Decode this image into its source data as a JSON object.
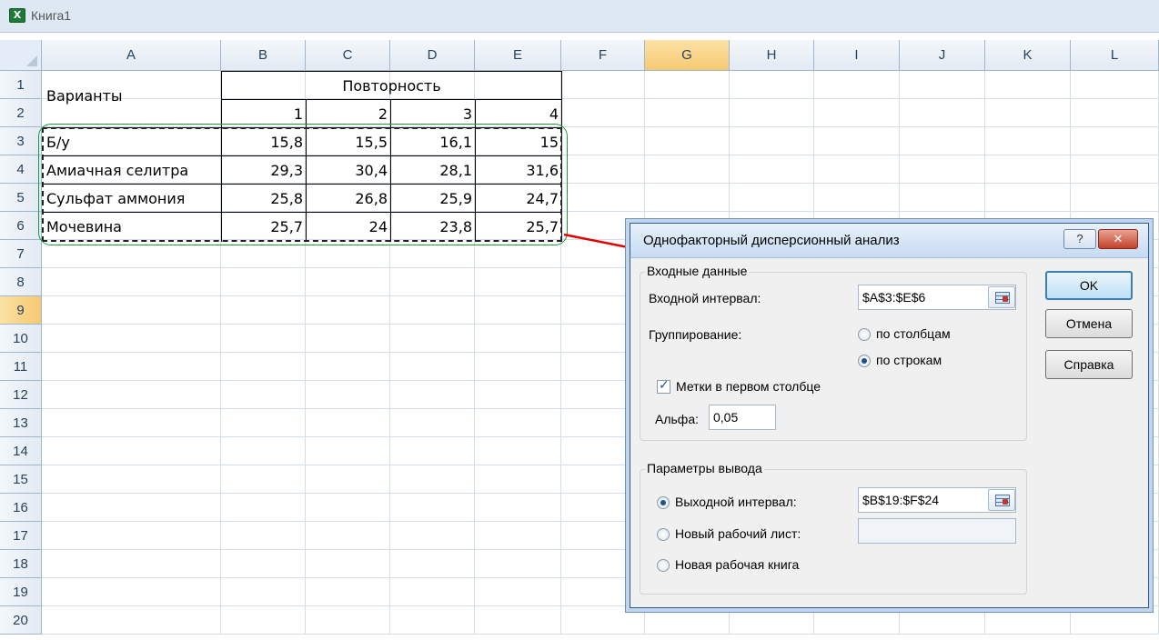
{
  "window": {
    "title": "Книга1",
    "app_icon": "excel-icon"
  },
  "columns": [
    "A",
    "B",
    "C",
    "D",
    "E",
    "F",
    "G",
    "H",
    "I",
    "J",
    "K",
    "L"
  ],
  "rows": [
    "1",
    "2",
    "3",
    "4",
    "5",
    "6",
    "7",
    "8",
    "9",
    "10",
    "11",
    "12",
    "13",
    "14",
    "15",
    "16",
    "17",
    "18",
    "19",
    "20"
  ],
  "active": {
    "column": "G",
    "row": "9"
  },
  "table": {
    "header_variants": "Варианты",
    "header_repeat": "Повторность",
    "repeat_numbers": [
      "1",
      "2",
      "3",
      "4"
    ],
    "data": [
      {
        "name": "Б/у",
        "values": [
          "15,8",
          "15,5",
          "16,1",
          "15"
        ]
      },
      {
        "name": "Амиачная селитра",
        "values": [
          "29,3",
          "30,4",
          "28,1",
          "31,6"
        ]
      },
      {
        "name": "Сульфат аммония",
        "values": [
          "25,8",
          "26,8",
          "25,9",
          "24,7"
        ]
      },
      {
        "name": "Мочевина",
        "values": [
          "25,7",
          "24",
          "23,8",
          "25,7"
        ]
      }
    ]
  },
  "dialog": {
    "title": "Однофакторный дисперсионный анализ",
    "help_glyph": "?",
    "close_glyph": "✕",
    "input_group": "Входные данные",
    "input_range_label": "Входной интервал:",
    "input_range_value": "$A$3:$E$6",
    "grouping_label": "Группирование:",
    "by_columns": "по столбцам",
    "by_rows": "по строкам",
    "labels_checkbox": "Метки в первом столбце",
    "alpha_label": "Альфа:",
    "alpha_value": "0,05",
    "output_group": "Параметры вывода",
    "output_range_label": "Выходной интервал:",
    "output_range_value": "$B$19:$F$24",
    "new_sheet": "Новый рабочий лист:",
    "new_sheet_value": "",
    "new_book": "Новая рабочая книга",
    "ok": "OK",
    "cancel": "Отмена",
    "help": "Справка",
    "selected_grouping": "by_rows",
    "selected_output": "output_range",
    "labels_checked": true
  },
  "colors": {
    "accent_arrow": "#e00000",
    "marquee_outline": "#1a9e3a",
    "header_selected": "#f7c870"
  }
}
